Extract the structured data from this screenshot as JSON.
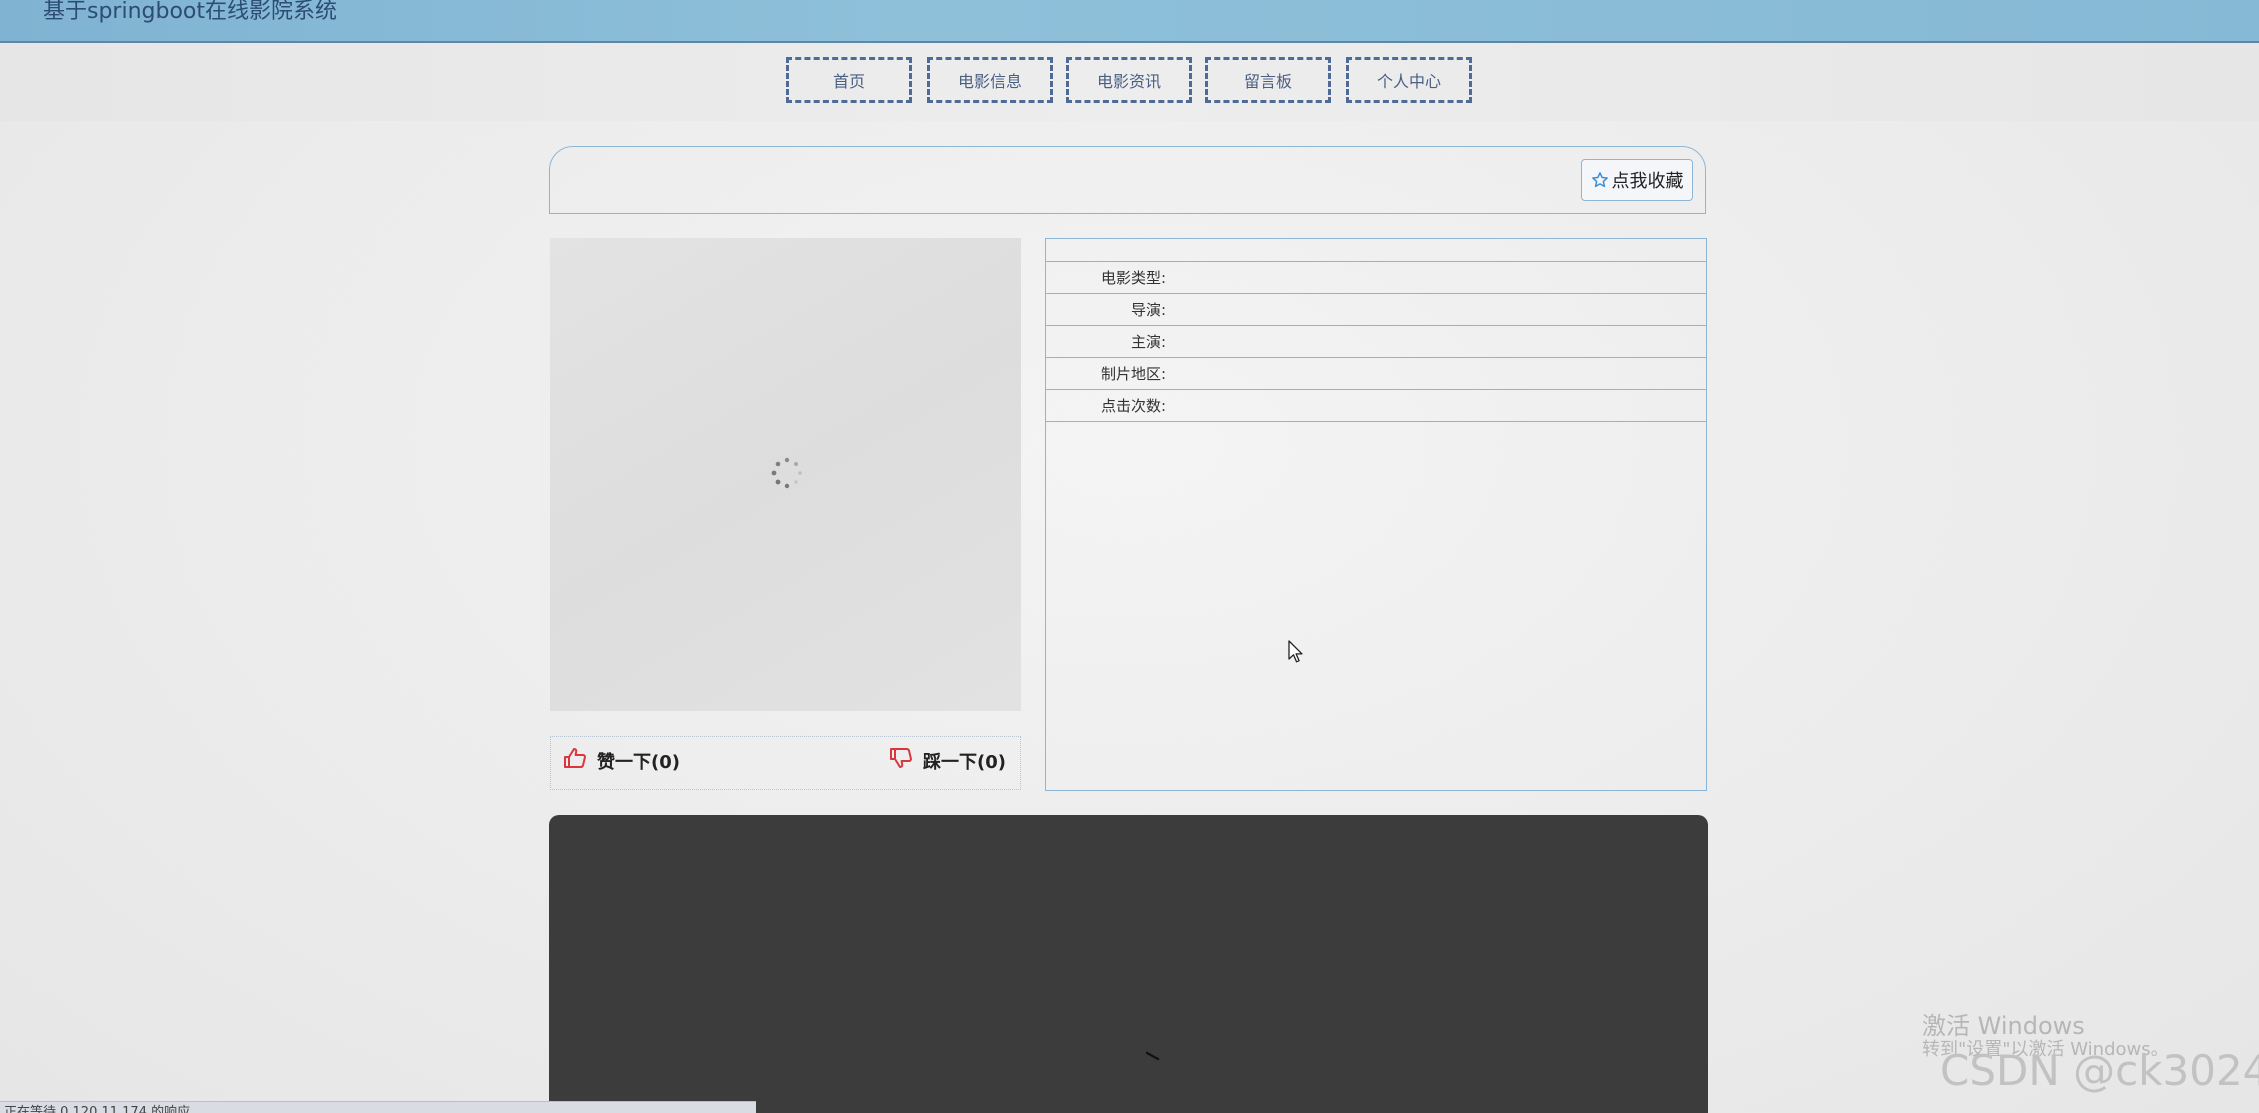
{
  "header": {
    "site_title": "基于springboot在线影院系统"
  },
  "nav": {
    "items": [
      {
        "label": "首页"
      },
      {
        "label": "电影信息"
      },
      {
        "label": "电影资讯"
      },
      {
        "label": "留言板"
      },
      {
        "label": "个人中心"
      }
    ]
  },
  "favorite": {
    "label": "点我收藏",
    "icon": "star-icon"
  },
  "poster": {
    "loading_icon": "spinner-icon"
  },
  "votes": {
    "like_label": "赞一下(0)",
    "like_icon": "thumbs-up-icon",
    "dislike_label": "踩一下(0)",
    "dislike_icon": "thumbs-down-icon"
  },
  "info": {
    "fields": [
      {
        "label": "电影类型:",
        "value": ""
      },
      {
        "label": "导演:",
        "value": ""
      },
      {
        "label": "主演:",
        "value": ""
      },
      {
        "label": "制片地区:",
        "value": ""
      },
      {
        "label": "点击次数:",
        "value": ""
      }
    ]
  },
  "status_bar": {
    "text": "正在等待 0.120.11.174 的响应..."
  },
  "watermarks": {
    "windows_title": "激活 Windows",
    "windows_sub": "转到\"设置\"以激活 Windows。",
    "csdn": "CSDN @ck3024"
  },
  "colors": {
    "accent": "#8cb6d6",
    "nav_border": "#4e6a96",
    "vote_icon": "#d9363e",
    "video_bg": "#3c3c3c"
  }
}
